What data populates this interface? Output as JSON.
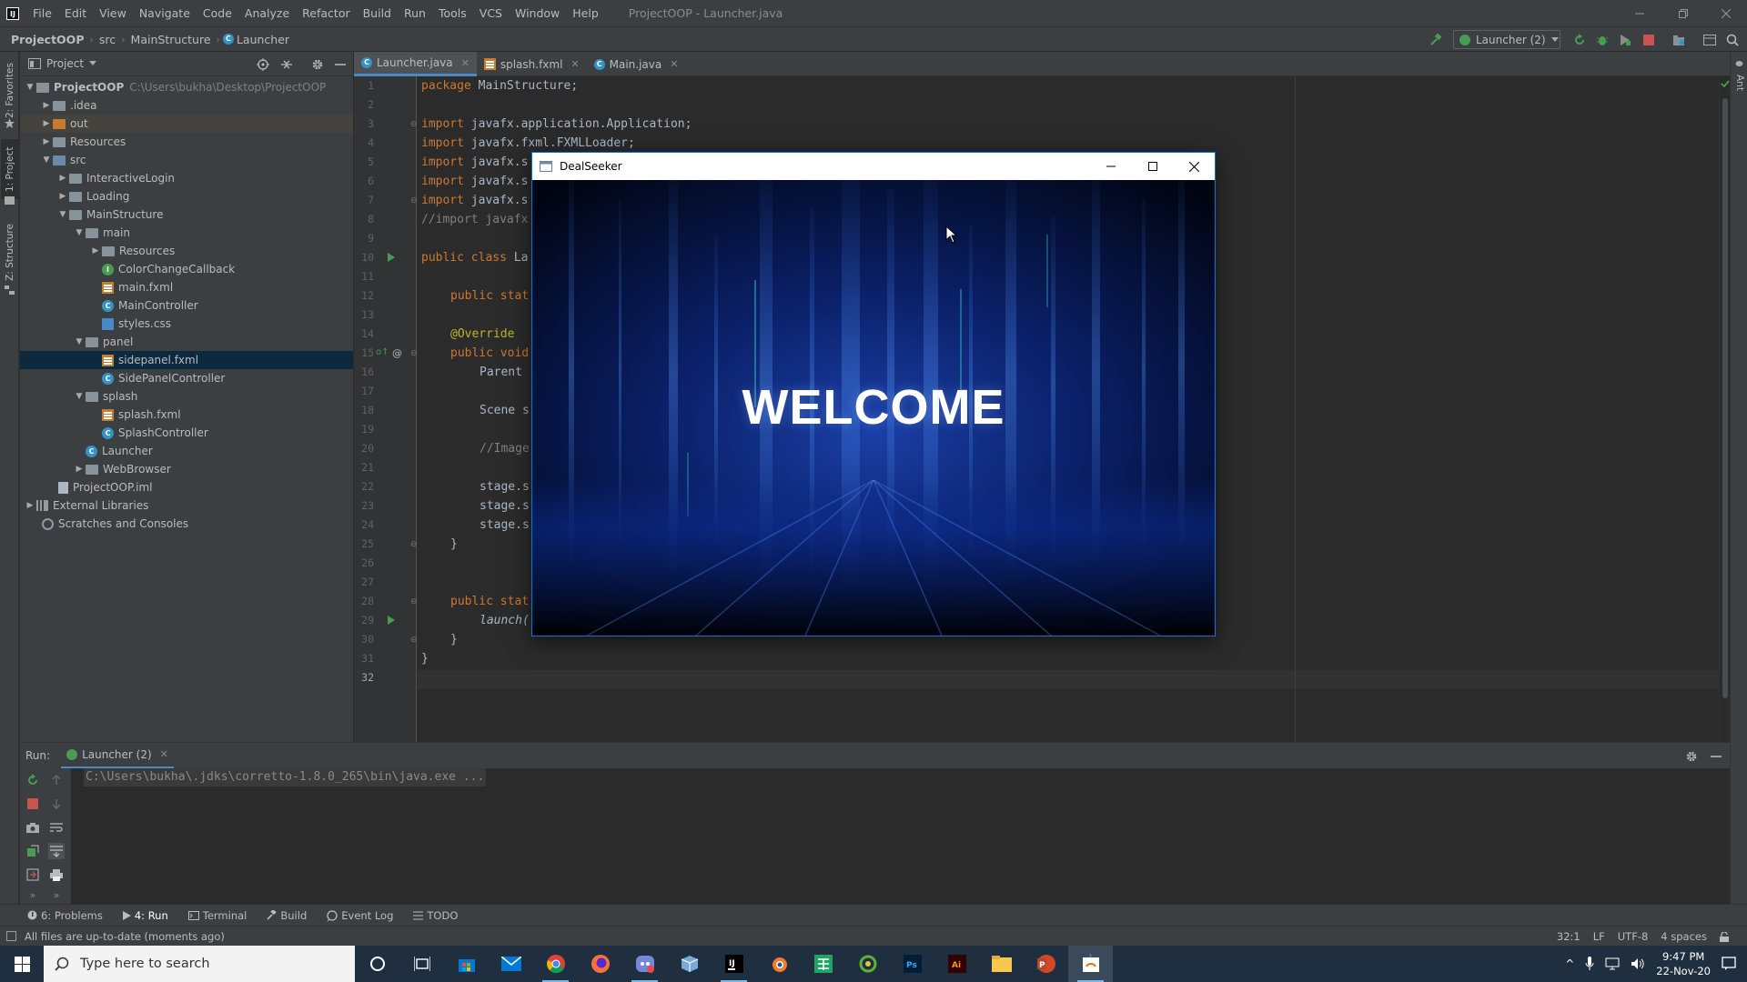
{
  "window": {
    "title": "ProjectOOP - Launcher.java"
  },
  "menu": [
    "File",
    "Edit",
    "View",
    "Navigate",
    "Code",
    "Analyze",
    "Refactor",
    "Build",
    "Run",
    "Tools",
    "VCS",
    "Window",
    "Help"
  ],
  "breadcrumb": {
    "project": "ProjectOOP",
    "items": [
      "src",
      "MainStructure",
      "Launcher"
    ]
  },
  "run_config": {
    "label": "Launcher (2)"
  },
  "left_strip": {
    "favorites": "2: Favorites",
    "project": "1: Project",
    "structure": "Z: Structure"
  },
  "right_strip": {
    "ant": "Ant"
  },
  "project_panel": {
    "title": "Project",
    "tree": [
      {
        "label": "ProjectOOP",
        "path": "C:\\Users\\bukha\\Desktop\\ProjectOOP",
        "icon": "folder-icon"
      },
      {
        "label": ".idea",
        "icon": "folder-icon"
      },
      {
        "label": "out",
        "icon": "folder-orange-icon"
      },
      {
        "label": "Resources",
        "icon": "folder-icon"
      },
      {
        "label": "src",
        "icon": "folder-blue-icon"
      },
      {
        "label": "InteractiveLogin",
        "icon": "package-icon"
      },
      {
        "label": "Loading",
        "icon": "package-icon"
      },
      {
        "label": "MainStructure",
        "icon": "package-icon"
      },
      {
        "label": "main",
        "icon": "package-icon"
      },
      {
        "label": "Resources",
        "icon": "package-icon"
      },
      {
        "label": "ColorChangeCallback",
        "icon": "interface-icon"
      },
      {
        "label": "main.fxml",
        "icon": "fxml-icon"
      },
      {
        "label": "MainController",
        "icon": "class-icon"
      },
      {
        "label": "styles.css",
        "icon": "css-icon"
      },
      {
        "label": "panel",
        "icon": "package-icon"
      },
      {
        "label": "sidepanel.fxml",
        "icon": "fxml-icon"
      },
      {
        "label": "SidePanelController",
        "icon": "class-icon"
      },
      {
        "label": "splash",
        "icon": "package-icon"
      },
      {
        "label": "splash.fxml",
        "icon": "fxml-icon"
      },
      {
        "label": "SplashController",
        "icon": "class-icon"
      },
      {
        "label": "Launcher",
        "icon": "class-icon"
      },
      {
        "label": "WebBrowser",
        "icon": "package-icon"
      },
      {
        "label": "ProjectOOP.iml",
        "icon": "iml-icon"
      },
      {
        "label": "External Libraries",
        "icon": "library-icon"
      },
      {
        "label": "Scratches and Consoles",
        "icon": "scratch-icon"
      }
    ]
  },
  "editor_tabs": [
    {
      "label": "Launcher.java",
      "active": true
    },
    {
      "label": "splash.fxml",
      "active": false
    },
    {
      "label": "Main.java",
      "active": false
    }
  ],
  "line_numbers": [
    "1",
    "2",
    "3",
    "4",
    "5",
    "6",
    "7",
    "8",
    "9",
    "10",
    "11",
    "12",
    "13",
    "14",
    "15",
    "16",
    "17",
    "18",
    "19",
    "20",
    "21",
    "22",
    "23",
    "24",
    "25",
    "26",
    "27",
    "28",
    "29",
    "30",
    "31",
    "32"
  ],
  "code_lines": {
    "l1_kw": "package",
    "l1_rest": " MainStructure;",
    "l3_kw": "import",
    "l3_rest": " javafx.application.Application;",
    "l4_kw": "import",
    "l4_rest": " javafx.fxml.FXMLLoader;",
    "l5_kw": "import",
    "l5_rest": " javafx.s",
    "l6_kw": "import",
    "l6_rest": " javafx.s",
    "l7_kw": "import",
    "l7_rest": " javafx.s",
    "l8": "//import javafx",
    "l10_kw": "public class",
    "l10_rest": " La",
    "l12_kw": "public stat",
    "l14": "@Override",
    "l15_kw": "public void",
    "l16": "Parent ",
    "l18": "Scene s",
    "l20": "//Image",
    "l22": "stage.s",
    "l23": "stage.s",
    "l24": "stage.s",
    "l25": "}",
    "l28_kw": "public stat",
    "l29": "launch(",
    "l30": "}",
    "l31": "}"
  },
  "dealseeker": {
    "title": "DealSeeker",
    "welcome": "WELCOME"
  },
  "run_panel": {
    "label": "Run:",
    "tab": "Launcher (2)",
    "console": "C:\\Users\\bukha\\.jdks\\corretto-1.8.0_265\\bin\\java.exe ..."
  },
  "tool_windows": [
    {
      "label": "6: Problems",
      "icon": "problems-icon"
    },
    {
      "label": "4: Run",
      "icon": "run-icon"
    },
    {
      "label": "Terminal",
      "icon": "terminal-icon"
    },
    {
      "label": "Build",
      "icon": "hammer-icon"
    },
    {
      "label": "Event Log",
      "icon": "event-log-icon"
    },
    {
      "label": "TODO",
      "icon": "todo-icon"
    }
  ],
  "status": {
    "message": "All files are up-to-date (moments ago)",
    "position": "32:1",
    "line_sep": "LF",
    "encoding": "UTF-8",
    "indent": "4 spaces"
  },
  "taskbar": {
    "search_placeholder": "Type here to search",
    "time": "9:47 PM",
    "date": "22-Nov-20"
  },
  "colors": {
    "keyword": "#cc7832",
    "annotation": "#bbb529",
    "comment": "#808080",
    "ide_bg": "#2b2b2b",
    "panel_bg": "#3c3f41",
    "selection": "#0d293e",
    "accent": "#4a88c7"
  }
}
